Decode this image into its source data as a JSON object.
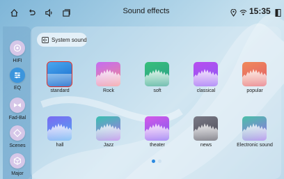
{
  "status_bar": {
    "title": "Sound effects",
    "time": "15:35",
    "icons": [
      "home-icon",
      "back-icon",
      "volume-icon",
      "recent-apps-icon",
      "location-icon",
      "wifi-icon",
      "battery-icon"
    ]
  },
  "sidebar": {
    "items": [
      {
        "label": "HIFI",
        "icon": "hifi-icon",
        "active": false
      },
      {
        "label": "EQ",
        "icon": "equalizer-icon",
        "active": true
      },
      {
        "label": "Fad-Bal",
        "icon": "fader-balance-icon",
        "active": false
      },
      {
        "label": "Scenes",
        "icon": "scenes-icon",
        "active": false
      },
      {
        "label": "Major",
        "icon": "major-icon",
        "active": false
      }
    ]
  },
  "main": {
    "system_sound_label": "System sound",
    "presets": [
      {
        "label": "standard",
        "colors": [
          "#4aa8f0",
          "#1565c8"
        ],
        "selected": true
      },
      {
        "label": "Rock",
        "colors": [
          "#c46cf2",
          "#f08a8a"
        ],
        "selected": false
      },
      {
        "label": "soft",
        "colors": [
          "#37c07a",
          "#2a9a8a"
        ],
        "selected": false
      },
      {
        "label": "classical",
        "colors": [
          "#b84ef0",
          "#8a5af2"
        ],
        "selected": false
      },
      {
        "label": "popular",
        "colors": [
          "#f08a5a",
          "#e05a6a"
        ],
        "selected": false
      },
      {
        "label": "hall",
        "colors": [
          "#7a6af2",
          "#4fa8f0"
        ],
        "selected": false
      },
      {
        "label": "Jazz",
        "colors": [
          "#3ac0b0",
          "#b070e8"
        ],
        "selected": false
      },
      {
        "label": "theater",
        "colors": [
          "#d45ae8",
          "#7a5af0"
        ],
        "selected": false
      },
      {
        "label": "news",
        "colors": [
          "#7a7a86",
          "#4a4a56"
        ],
        "selected": false
      },
      {
        "label": "Electronic sound",
        "colors": [
          "#4ac0a8",
          "#9a6ae8"
        ],
        "selected": false
      }
    ],
    "page_indicator": {
      "pages": 2,
      "current": 1
    }
  }
}
